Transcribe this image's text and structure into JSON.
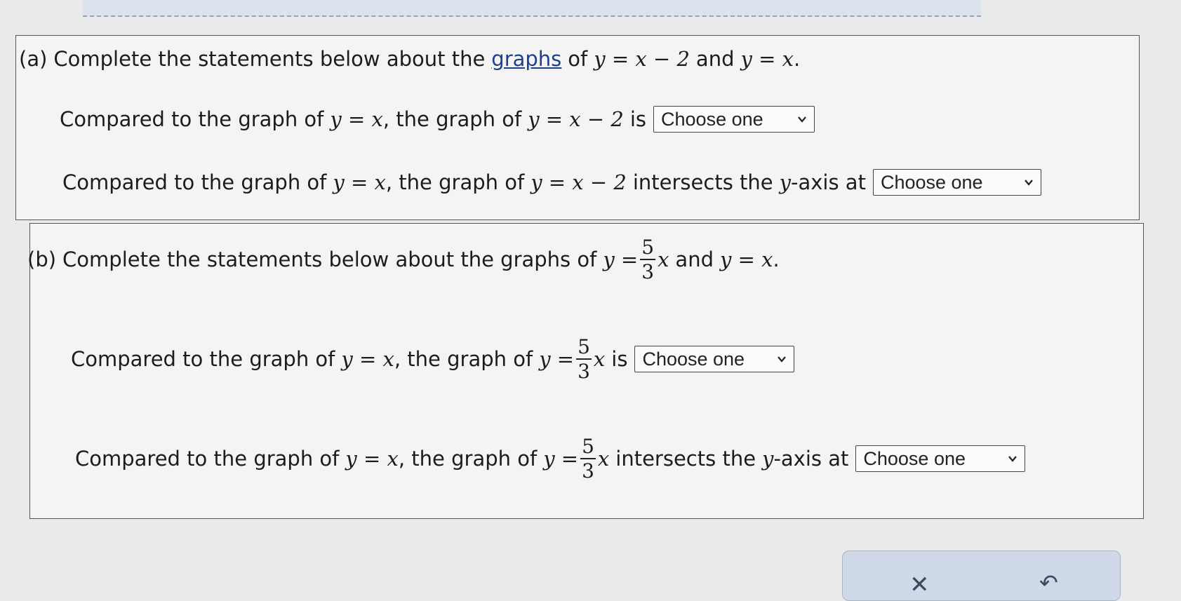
{
  "part_a": {
    "heading": {
      "label": "(a)",
      "pre": "Complete the statements below about the",
      "link": "graphs",
      "mid": "of",
      "eq1": "y = x − 2",
      "and": "and",
      "eq2": "y = x",
      "end": "."
    },
    "s1": {
      "pre": "Compared to the graph of",
      "eq1": "y = x",
      "mid": ", the graph of",
      "eq2": "y = x − 2",
      "post": "is",
      "select": "Choose one"
    },
    "s2": {
      "pre": "Compared to the graph of",
      "eq1": "y = x",
      "mid": ", the graph of",
      "eq2": "y = x − 2",
      "post1": "intersects the",
      "axis": "y",
      "post2": "-axis at",
      "select": "Choose one"
    }
  },
  "part_b": {
    "heading": {
      "label": "(b)",
      "pre": "Complete the statements below about the graphs of",
      "lhs": "y =",
      "num": "5",
      "den": "3",
      "var": "x",
      "and": "and",
      "eq2": "y = x",
      "end": "."
    },
    "s1": {
      "pre": "Compared to the graph of",
      "eq1": "y = x",
      "mid": ", the graph of",
      "lhs": "y =",
      "num": "5",
      "den": "3",
      "var": "x",
      "post": "is",
      "select": "Choose one"
    },
    "s2": {
      "pre": "Compared to the graph of",
      "eq1": "y = x",
      "mid": ", the graph of",
      "lhs": "y =",
      "num": "5",
      "den": "3",
      "var": "x",
      "post1": "intersects the",
      "axis": "y",
      "post2": "-axis at",
      "select": "Choose one"
    }
  },
  "buttons": {
    "clear_icon": "✕",
    "undo_icon": "↶"
  }
}
